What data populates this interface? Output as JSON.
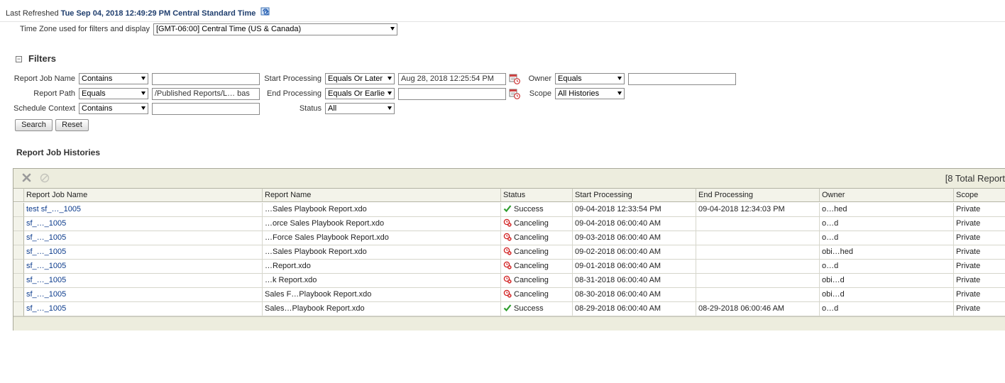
{
  "header": {
    "last_refreshed_label": "Last Refreshed",
    "last_refreshed_value": "Tue Sep 04, 2018 12:49:29 PM Central Standard Time",
    "timezone_label": "Time Zone used for filters and display",
    "timezone_value": "[GMT-06:00] Central Time (US & Canada)"
  },
  "filters": {
    "title": "Filters",
    "toggle": "−",
    "report_job_name": {
      "label": "Report Job Name",
      "operator": "Contains",
      "value": ""
    },
    "report_path": {
      "label": "Report Path",
      "operator": "Equals",
      "value": "/Published Reports/L…      bas"
    },
    "schedule_context": {
      "label": "Schedule Context",
      "operator": "Contains",
      "value": ""
    },
    "start_processing": {
      "label": "Start Processing",
      "operator": "Equals Or Later",
      "value": "Aug 28, 2018 12:25:54 PM"
    },
    "end_processing": {
      "label": "End Processing",
      "operator": "Equals Or Earlie",
      "value": ""
    },
    "status": {
      "label": "Status",
      "value": "All"
    },
    "owner": {
      "label": "Owner",
      "operator": "Equals",
      "value": ""
    },
    "scope": {
      "label": "Scope",
      "value": "All Histories"
    },
    "search_label": "Search",
    "reset_label": "Reset"
  },
  "histories": {
    "title": "Report Job Histories",
    "total_text": "[8 Total Report",
    "columns": [
      "Report Job Name",
      "Report Name",
      "Status",
      "Start Processing",
      "End Processing",
      "Owner",
      "Scope"
    ],
    "rows": [
      {
        "job": "test sf_…_1005",
        "report": "…Sales Playbook Report.xdo",
        "status": "Success",
        "start": "09-04-2018 12:33:54 PM",
        "end": "09-04-2018 12:34:03 PM",
        "owner": "o…hed",
        "scope": "Private"
      },
      {
        "job": "sf_…_1005",
        "report": "…orce Sales Playbook Report.xdo",
        "status": "Canceling",
        "start": "09-04-2018 06:00:40 AM",
        "end": "",
        "owner": "o…d",
        "scope": "Private"
      },
      {
        "job": "sf_…_1005",
        "report": "…Force Sales Playbook Report.xdo",
        "status": "Canceling",
        "start": "09-03-2018 06:00:40 AM",
        "end": "",
        "owner": "o…d",
        "scope": "Private"
      },
      {
        "job": "sf_…_1005",
        "report": "…Sales Playbook Report.xdo",
        "status": "Canceling",
        "start": "09-02-2018 06:00:40 AM",
        "end": "",
        "owner": "obi…hed",
        "scope": "Private"
      },
      {
        "job": "sf_…_1005",
        "report": "…Report.xdo",
        "status": "Canceling",
        "start": "09-01-2018 06:00:40 AM",
        "end": "",
        "owner": "o…d",
        "scope": "Private"
      },
      {
        "job": "sf_…_1005",
        "report": "…k Report.xdo",
        "status": "Canceling",
        "start": "08-31-2018 06:00:40 AM",
        "end": "",
        "owner": "obi…d",
        "scope": "Private"
      },
      {
        "job": "sf_…_1005",
        "report": "Sales F…Playbook Report.xdo",
        "status": "Canceling",
        "start": "08-30-2018 06:00:40 AM",
        "end": "",
        "owner": "obi…d",
        "scope": "Private"
      },
      {
        "job": "sf_…_1005",
        "report": "Sales…Playbook Report.xdo",
        "status": "Success",
        "start": "08-29-2018 06:00:40 AM",
        "end": "08-29-2018 06:00:46 AM",
        "owner": "o…d",
        "scope": "Private"
      }
    ]
  },
  "icons": {
    "refresh": "refresh-icon",
    "calendar": "calendar-clock-icon",
    "delete": "delete-x-icon",
    "cancel": "cancel-circle-icon",
    "success": "check-icon",
    "canceling": "canceling-icon"
  },
  "colors": {
    "link": "#0b3b8c",
    "success": "#2e9e2e",
    "canceling": "#d21f1f",
    "panel": "#ededde"
  }
}
